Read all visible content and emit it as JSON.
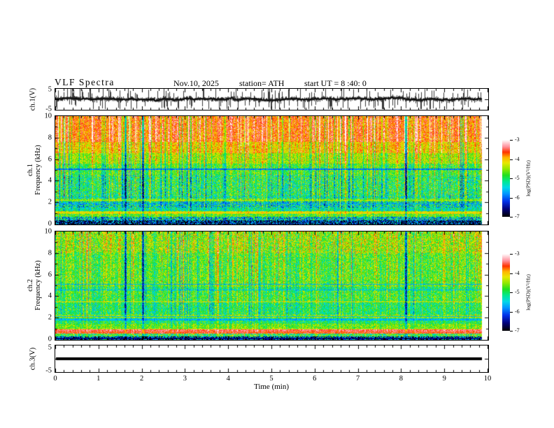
{
  "header": {
    "title": "VLF  Spectra",
    "date": "Nov.10, 2025",
    "station": "station= ATH",
    "start_ut": "start UT =  8 :40: 0"
  },
  "axes": {
    "time": {
      "label": "Time  (min)",
      "min": 0,
      "max": 10,
      "tick_labels": [
        "0",
        "1",
        "2",
        "3",
        "4",
        "5",
        "6",
        "7",
        "8",
        "9",
        "10"
      ],
      "minor_per_major": 4
    },
    "freq": {
      "label": "Frequency  (kHz)",
      "min": 0,
      "max": 10,
      "tick_values": [
        0,
        2,
        4,
        6,
        8,
        10
      ],
      "tick_labels": [
        "0",
        "2",
        "4",
        "6",
        "8",
        "10"
      ],
      "minor_values": [
        1,
        3,
        5,
        7,
        9
      ]
    },
    "volt": {
      "min": -5,
      "max": 5,
      "tick_values": [
        5,
        0,
        -5
      ],
      "tick_labels_shown": [
        "5",
        "-5"
      ]
    }
  },
  "panels": {
    "wave": {
      "ylabel": "ch.1(V)",
      "ytick_top": "5",
      "ytick_bottom": "-5"
    },
    "spec1": {
      "ylabel_line1": "ch.1",
      "ylabel_line2": "Frequency  (kHz)"
    },
    "spec2": {
      "ylabel_line1": "ch.2",
      "ylabel_line2": "Frequency  (kHz)"
    },
    "ch3": {
      "ylabel": "ch.3(V)",
      "ytick_top": "5",
      "ytick_bottom": "-5"
    }
  },
  "colorbar": {
    "label": "log(PSD)(V²/Hz)",
    "tick_labels": [
      "-3",
      "-4",
      "-5",
      "-6",
      "-7"
    ],
    "zlim": [
      -7,
      -3
    ],
    "stops": [
      [
        0.0,
        "#000000"
      ],
      [
        0.1,
        "#000078"
      ],
      [
        0.2,
        "#0030e8"
      ],
      [
        0.3,
        "#0096ff"
      ],
      [
        0.38,
        "#00d8e8"
      ],
      [
        0.46,
        "#00e890"
      ],
      [
        0.54,
        "#20e020"
      ],
      [
        0.62,
        "#90e800"
      ],
      [
        0.7,
        "#e8e800"
      ],
      [
        0.77,
        "#ffb400"
      ],
      [
        0.84,
        "#ff3300"
      ],
      [
        0.91,
        "#ff8f9b"
      ],
      [
        1.0,
        "#ffffff"
      ]
    ]
  },
  "chart_data": [
    {
      "type": "line",
      "panel": "ch1-waveform",
      "ylabel": "ch.1(V)",
      "xlim": [
        0,
        10
      ],
      "ylim": [
        -5,
        5
      ],
      "description": "Broadband VLF time series: dense noise band of roughly ±1.5 V around 0 with frequent impulsive sferic spikes reaching ±5 V; trace ends at 9.85 min",
      "data_end_min": 9.85,
      "noise_sigma": 0.75,
      "spike_probability": 0.05,
      "spike_amplitude": [
        2,
        5
      ],
      "seed": 31
    },
    {
      "type": "heatmap",
      "panel": "ch1-spectrogram",
      "ylabel": "ch.1 Frequency (kHz)",
      "xlim": [
        0,
        10
      ],
      "ylim": [
        0,
        10
      ],
      "zlabel": "log(PSD)(V²/Hz)",
      "zlim": [
        -7,
        -3
      ],
      "data_end_min": 9.85,
      "seed": 7,
      "streaks": {
        "bright_p": 0.12,
        "bright": [
          0.1,
          0.22
        ],
        "dark_p": 0.1,
        "dark": [
          0.12,
          0.28
        ],
        "jitter": 0.07
      },
      "bands": [
        {
          "f_to": 0.35,
          "v": 0.14,
          "n": 0.3,
          "w": 0.4
        },
        {
          "f_to": 0.7,
          "v": 0.38,
          "n": 0.26,
          "w": 0.5
        },
        {
          "f_to": 0.95,
          "v": 0.56,
          "n": 0.14,
          "w": 0.5
        },
        {
          "f_to": 1.2,
          "v": 0.67,
          "n": 0.1,
          "w": 0.4
        },
        {
          "f_to": 1.5,
          "v": 0.45,
          "n": 0.14,
          "w": 0.5
        },
        {
          "f_to": 2.1,
          "v": 0.41,
          "n": 0.22,
          "w": 0.6
        },
        {
          "f_to": 2.35,
          "v": 0.58,
          "n": 0.14,
          "w": 0.6
        },
        {
          "f_to": 2.6,
          "v": 0.46,
          "n": 0.18,
          "w": 0.8
        },
        {
          "f_to": 4.6,
          "v": 0.5,
          "n": 0.17,
          "w": 1.0
        },
        {
          "f_to": 5.6,
          "v": 0.55,
          "n": 0.13,
          "w": 1.0
        },
        {
          "f_to": 6.6,
          "v": 0.64,
          "n": 0.12,
          "w": 1.0
        },
        {
          "f_to": 7.6,
          "v": 0.73,
          "n": 0.11,
          "w": 1.0
        },
        {
          "f_to": 10.0,
          "v": 0.82,
          "n": 0.1,
          "w": 1.0
        }
      ],
      "hlines": [
        {
          "f": 5.1,
          "v": 0.27,
          "hw": 0.04
        },
        {
          "f": 2.2,
          "v": 0.64,
          "hw": 0.045
        },
        {
          "f": 1.9,
          "v": 0.32,
          "hw": 0.035
        },
        {
          "f": 1.05,
          "v": 0.72,
          "hw": 0.07
        },
        {
          "f": 0.8,
          "v": 0.6,
          "hw": 0.04
        }
      ],
      "gap_times_min": [
        1.62,
        2.02,
        8.1
      ]
    },
    {
      "type": "heatmap",
      "panel": "ch2-spectrogram",
      "ylabel": "ch.2 Frequency (kHz)",
      "xlim": [
        0,
        10
      ],
      "ylim": [
        0,
        10
      ],
      "zlabel": "log(PSD)(V²/Hz)",
      "zlim": [
        -7,
        -3
      ],
      "data_end_min": 9.85,
      "seed": 99,
      "streaks": {
        "bright_p": 0.14,
        "bright": [
          0.08,
          0.2
        ],
        "dark_p": 0.08,
        "dark": [
          0.1,
          0.22
        ],
        "jitter": 0.07
      },
      "bands": [
        {
          "f_to": 0.3,
          "v": 0.22,
          "n": 0.34,
          "w": 0.5
        },
        {
          "f_to": 0.55,
          "v": 0.52,
          "n": 0.2,
          "w": 0.5
        },
        {
          "f_to": 0.75,
          "v": 0.85,
          "n": 0.07,
          "w": 0.2
        },
        {
          "f_to": 1.0,
          "v": 0.68,
          "n": 0.1,
          "w": 0.3
        },
        {
          "f_to": 1.45,
          "v": 0.58,
          "n": 0.12,
          "w": 0.5
        },
        {
          "f_to": 1.75,
          "v": 0.5,
          "n": 0.14,
          "w": 0.5
        },
        {
          "f_to": 2.0,
          "v": 0.43,
          "n": 0.13,
          "w": 0.5
        },
        {
          "f_to": 2.3,
          "v": 0.6,
          "n": 0.15,
          "w": 0.5
        },
        {
          "f_to": 3.4,
          "v": 0.49,
          "n": 0.14,
          "w": 0.8
        },
        {
          "f_to": 4.5,
          "v": 0.53,
          "n": 0.14,
          "w": 0.9
        },
        {
          "f_to": 4.9,
          "v": 0.49,
          "n": 0.14,
          "w": 0.9
        },
        {
          "f_to": 8.0,
          "v": 0.56,
          "n": 0.14,
          "w": 1.0
        },
        {
          "f_to": 10.0,
          "v": 0.62,
          "n": 0.16,
          "w": 1.0
        }
      ],
      "hlines": [
        {
          "f": 5.1,
          "v": 0.33,
          "hw": 0.035
        },
        {
          "f": 4.6,
          "v": 0.34,
          "hw": 0.035
        },
        {
          "f": 3.5,
          "v": 0.7,
          "hw": 0.04
        },
        {
          "f": 2.12,
          "v": 0.36,
          "hw": 0.03
        },
        {
          "f": 1.85,
          "v": 0.33,
          "hw": 0.04
        },
        {
          "f": 0.85,
          "v": 0.88,
          "hw": 0.1
        },
        {
          "f": 0.12,
          "v": 0.1,
          "hw": 0.07
        }
      ],
      "gap_times_min": [
        1.62,
        2.02,
        8.1
      ]
    },
    {
      "type": "line",
      "panel": "ch3-waveform",
      "ylabel": "ch.3(V)",
      "xlim": [
        0,
        10
      ],
      "ylim": [
        -5,
        5
      ],
      "description": "Constant flat trace at 0 V (thick black line), ending at 9.85 min",
      "constant_value": 0,
      "data_end_min": 9.85
    }
  ]
}
